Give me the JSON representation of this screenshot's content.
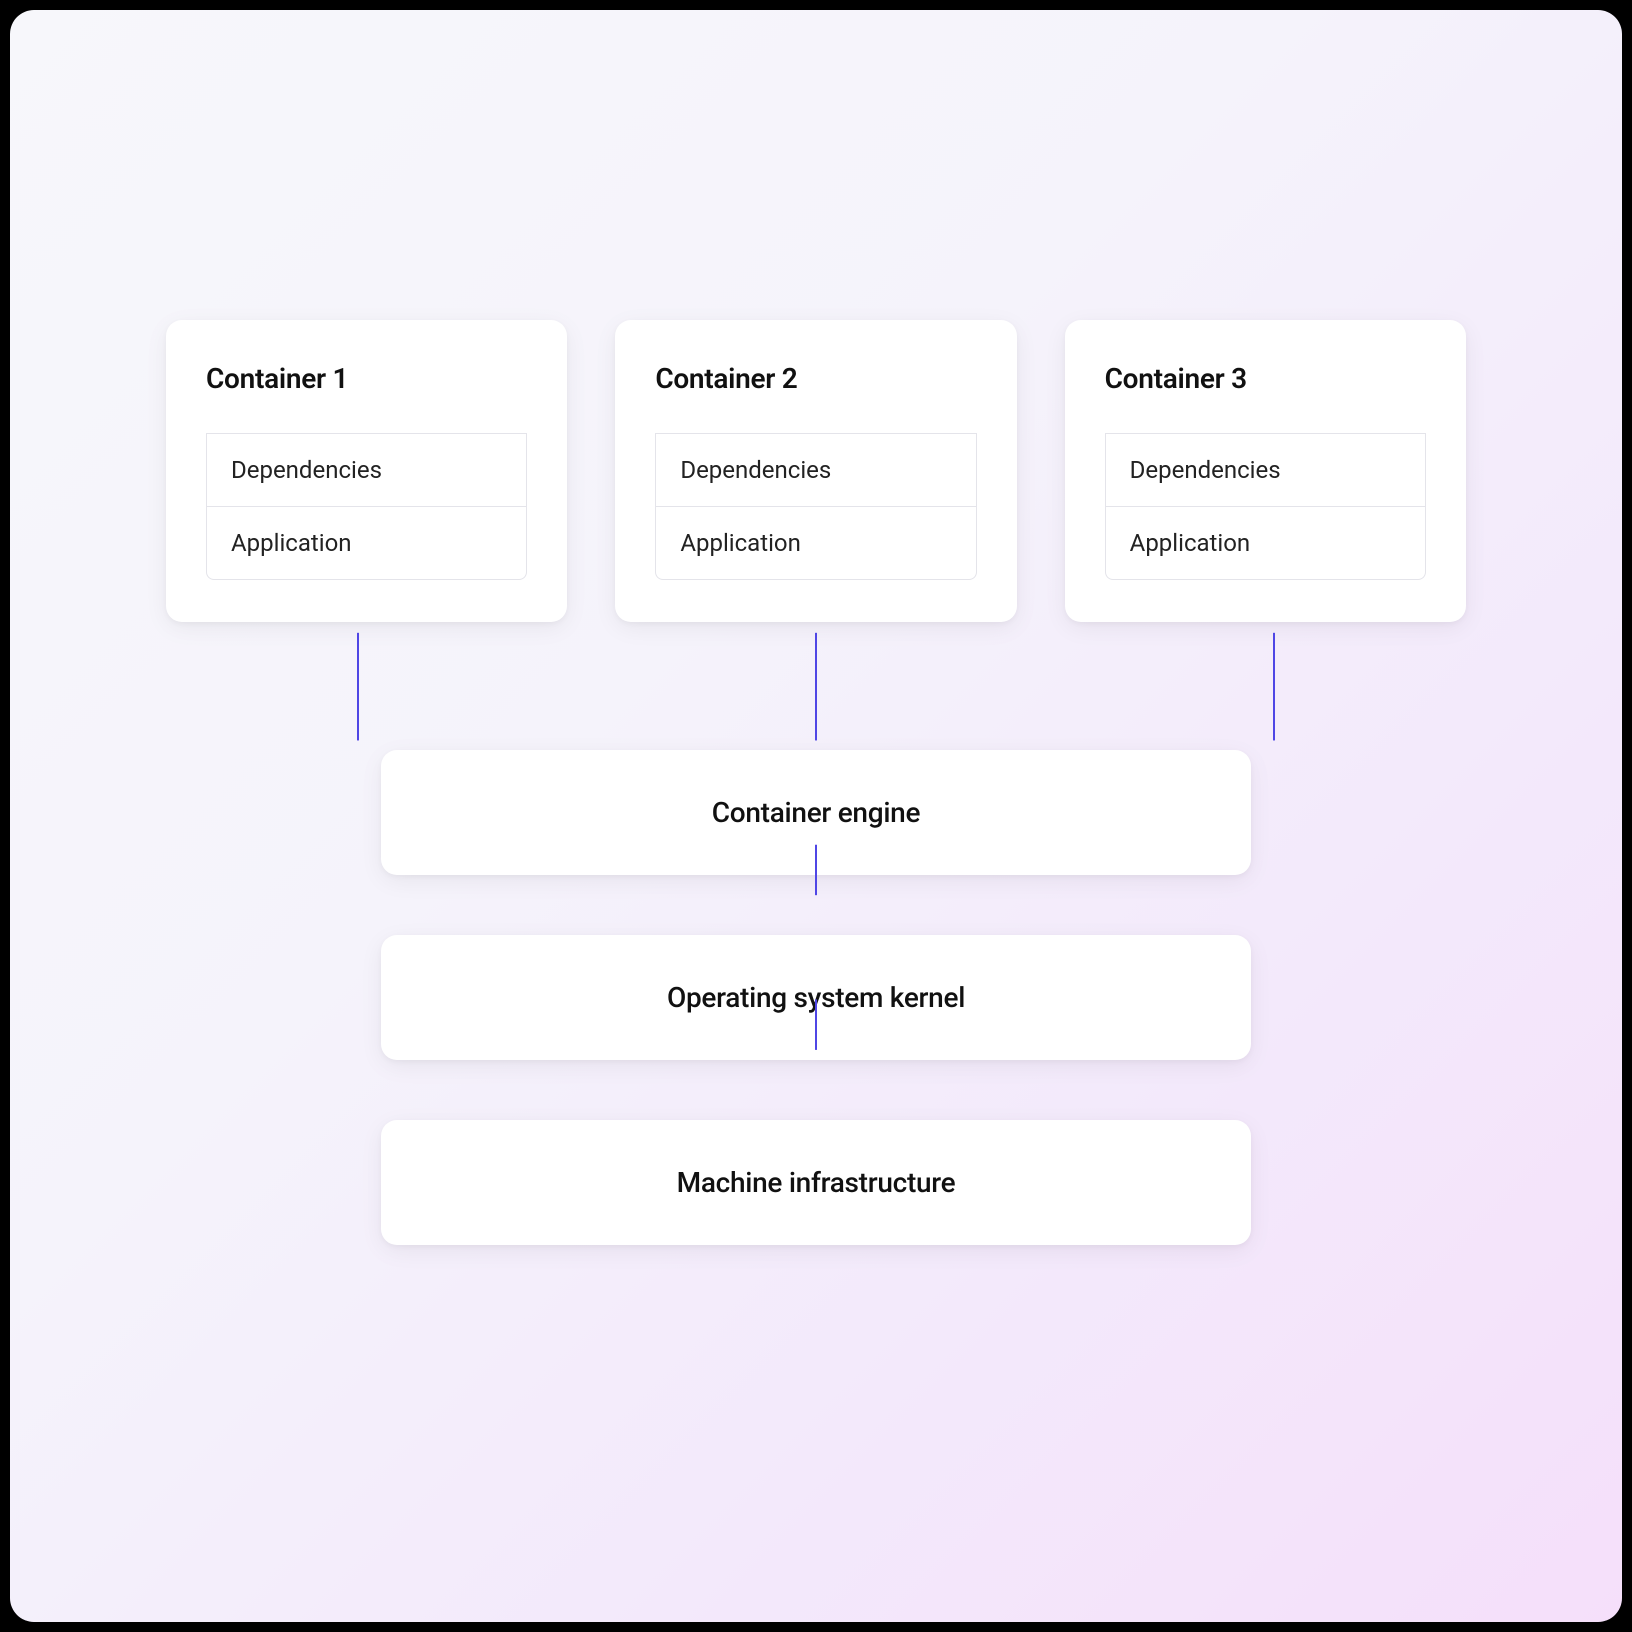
{
  "containers": [
    {
      "title": "Container 1",
      "dependencies_label": "Dependencies",
      "application_label": "Application"
    },
    {
      "title": "Container 2",
      "dependencies_label": "Dependencies",
      "application_label": "Application"
    },
    {
      "title": "Container 3",
      "dependencies_label": "Dependencies",
      "application_label": "Application"
    }
  ],
  "layers": {
    "engine": "Container engine",
    "kernel": "Operating system kernel",
    "infrastructure": "Machine infrastructure"
  },
  "colors": {
    "connector": "#4f46e5",
    "card_bg": "#ffffff",
    "border": "#e4e4ea"
  }
}
